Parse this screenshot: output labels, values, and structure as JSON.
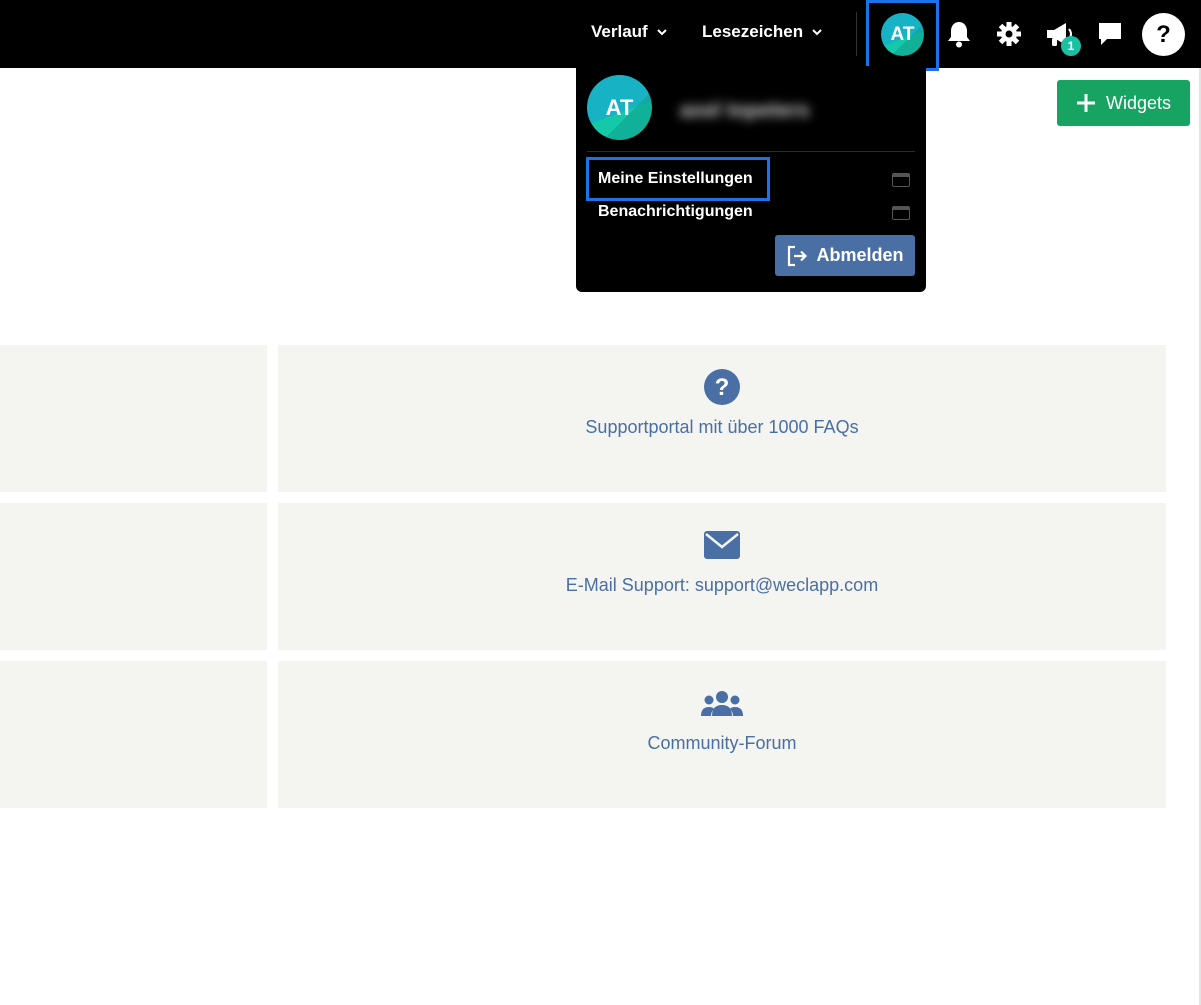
{
  "topbar": {
    "history_label": "Verlauf",
    "bookmarks_label": "Lesezeichen",
    "avatar_initials": "AT",
    "announcement_count": "1",
    "help_glyph": "?"
  },
  "dropdown": {
    "avatar_initials": "AT",
    "username": "axel topeters",
    "items": [
      {
        "label": "Meine Einstellungen"
      },
      {
        "label": "Benachrichtigungen"
      }
    ],
    "logout_label": "Abmelden"
  },
  "widgets_button": {
    "label": "Widgets"
  },
  "support_cards": [
    {
      "label": "Supportportal mit über 1000 FAQs",
      "icon": "question-circle-icon"
    },
    {
      "label": "E-Mail Support: support@weclapp.com",
      "icon": "envelope-icon"
    },
    {
      "label": "Community-Forum",
      "icon": "users-icon"
    }
  ],
  "colors": {
    "topbar_bg": "#000000",
    "highlight_border": "#1a73e8",
    "widgets_green": "#17a463",
    "logout_blue": "#4a6fa5",
    "link_blue": "#4a6fa5",
    "card_bg": "#f4f4f1",
    "badge_teal": "#1bc0a4"
  }
}
